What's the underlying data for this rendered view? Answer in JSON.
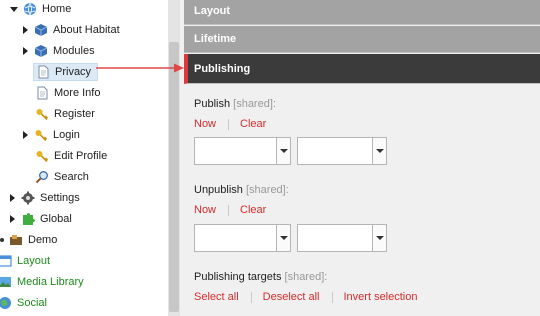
{
  "tree": {
    "items": [
      {
        "label": "Home",
        "icon": "home-globe-icon"
      },
      {
        "label": "About Habitat",
        "icon": "cube-icon"
      },
      {
        "label": "Modules",
        "icon": "cube-icon"
      },
      {
        "label": "Privacy",
        "icon": "document-icon"
      },
      {
        "label": "More Info",
        "icon": "document-icon"
      },
      {
        "label": "Register",
        "icon": "key-icon"
      },
      {
        "label": "Login",
        "icon": "key-icon"
      },
      {
        "label": "Edit Profile",
        "icon": "key-icon"
      },
      {
        "label": "Search",
        "icon": "magnifier-icon"
      },
      {
        "label": "Settings",
        "icon": "gear-icon"
      },
      {
        "label": "Global",
        "icon": "puzzle-icon"
      },
      {
        "label": "Demo",
        "icon": "demo-icon"
      },
      {
        "label": "Layout",
        "icon": "layout-icon"
      },
      {
        "label": "Media Library",
        "icon": "media-icon"
      },
      {
        "label": "Social",
        "icon": "social-icon"
      }
    ]
  },
  "sections": {
    "layout": "Layout",
    "lifetime": "Lifetime",
    "publishing": "Publishing"
  },
  "publishing": {
    "publish_label": "Publish",
    "unpublish_label": "Unpublish",
    "targets_label": "Publishing targets",
    "shared_tag": "[shared]:",
    "now": "Now",
    "clear": "Clear",
    "select_all": "Select all",
    "deselect_all": "Deselect all",
    "invert_selection": "Invert selection"
  },
  "colors": {
    "accent": "#dc3a3a",
    "link": "#d42b2b",
    "section_header": "#a3a3a3",
    "active_header": "#3b3b3b",
    "green_label": "#1e8a1e"
  }
}
